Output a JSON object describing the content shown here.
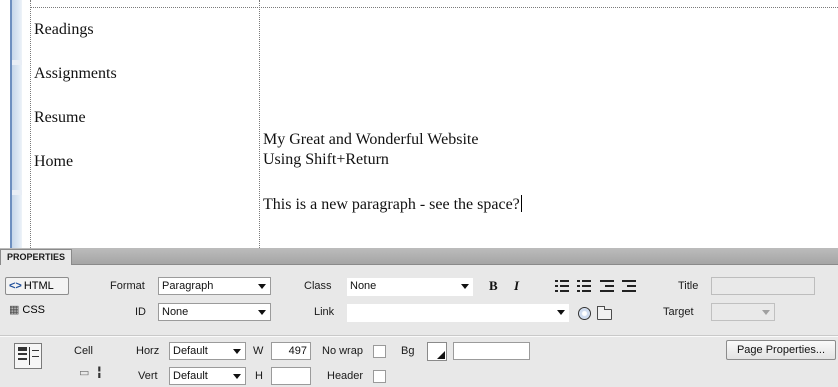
{
  "design_view": {
    "nav_items": [
      "Readings",
      "Assignments",
      "Resume",
      "Home"
    ],
    "content_lines": [
      "My Great and Wonderful Website",
      "Using Shift+Return",
      "This is a new paragraph - see the space?"
    ]
  },
  "properties": {
    "tab_label": "PROPERTIES",
    "mode_html": "HTML",
    "mode_css": "CSS",
    "format_label": "Format",
    "format_value": "Paragraph",
    "class_label": "Class",
    "class_value": "None",
    "bold": "B",
    "italic": "I",
    "title_label": "Title",
    "title_value": "",
    "id_label": "ID",
    "id_value": "None",
    "link_label": "Link",
    "link_value": "",
    "target_label": "Target",
    "target_value": ""
  },
  "cell": {
    "cell_label": "Cell",
    "horz_label": "Horz",
    "horz_value": "Default",
    "w_label": "W",
    "w_value": "497",
    "nowrap_label": "No wrap",
    "bg_label": "Bg",
    "bg_value": "",
    "vert_label": "Vert",
    "vert_value": "Default",
    "h_label": "H",
    "h_value": "",
    "header_label": "Header",
    "page_properties_label": "Page Properties..."
  },
  "icons": {
    "html_icon": "<>",
    "css_icon": "css-icon",
    "merge_icon": "merge-cells-icon",
    "split_icon": "split-cells-icon"
  }
}
